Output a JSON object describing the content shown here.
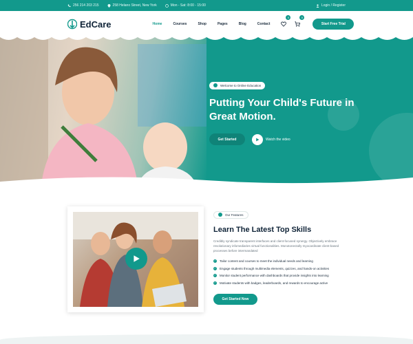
{
  "topbar": {
    "phone": "256 214 203 215",
    "address": "258 Helano Street, New York",
    "hours": "Mon - Sat: 8:00 - 15:00",
    "login": "Login / Register"
  },
  "brand": {
    "name": "EdCare"
  },
  "nav": {
    "items": [
      {
        "label": "Home",
        "active": true
      },
      {
        "label": "Courses"
      },
      {
        "label": "Shop"
      },
      {
        "label": "Pages"
      },
      {
        "label": "Blog"
      },
      {
        "label": "Contact"
      }
    ],
    "wishlist_count": "0",
    "cart_count": "0",
    "cta": "Start Free Trial"
  },
  "hero": {
    "tag": "Welcome to Online Education",
    "headline": "Putting Your Child's Future in Great Motion.",
    "primary_cta": "Get Started",
    "video_label": "Watch the video"
  },
  "features": {
    "tag": "Our Features",
    "title": "Learn The Latest Top Skills",
    "body": "Credibly syndicate transparent interfaces and client-focused synergy. Objectively embrace revolutionary infomediaries virtual functionalities. Monotonectally myocardinate client-based processes before intermandated",
    "bullets": [
      "Tailor content and courses to meet the individual needs and learning",
      "Engage students through multimedia elements, quizzes, and hands-on activities",
      "Monitor student performance with dashboards that provide insights into learning",
      "Motivate students with badges, leaderboards, and rewards to encourage active"
    ],
    "cta": "Get Started Now"
  },
  "colors": {
    "accent": "#12998c",
    "dark": "#0f2337"
  }
}
